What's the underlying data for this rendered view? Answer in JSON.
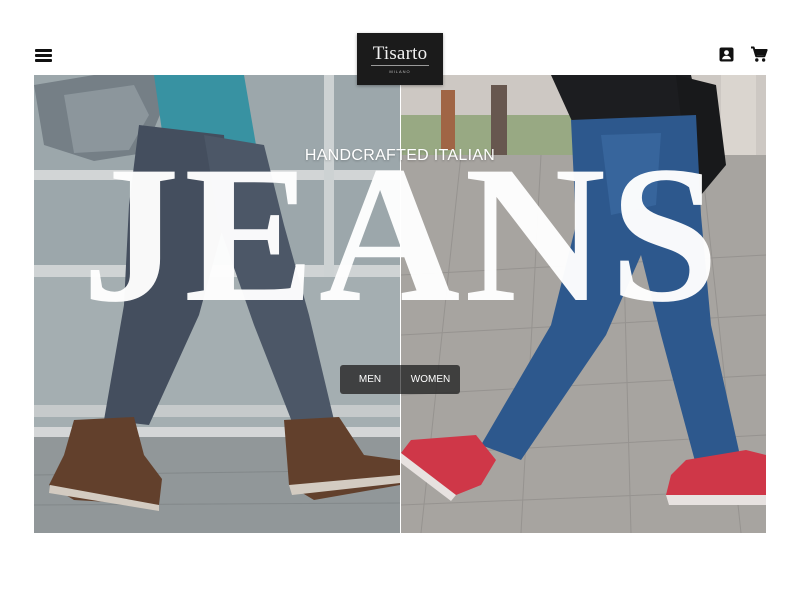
{
  "header": {
    "menu_icon": "hamburger-menu-icon",
    "logo": {
      "brand": "Tisarto",
      "city": "MILANO"
    },
    "account_icon": "account-box-icon",
    "cart_icon": "shopping-cart-icon"
  },
  "hero": {
    "eyebrow": "HANDCRAFTED ITALIAN",
    "headline": "JEANS",
    "buttons": {
      "men": "MEN",
      "women": "WOMEN"
    },
    "colors": {
      "overlay_text": "#ffffff",
      "button_bg": "#282828",
      "men_denim": "#4a5566",
      "women_denim": "#2f5c93",
      "sneakers": "#d83a4b",
      "boots": "#6b4630"
    }
  }
}
